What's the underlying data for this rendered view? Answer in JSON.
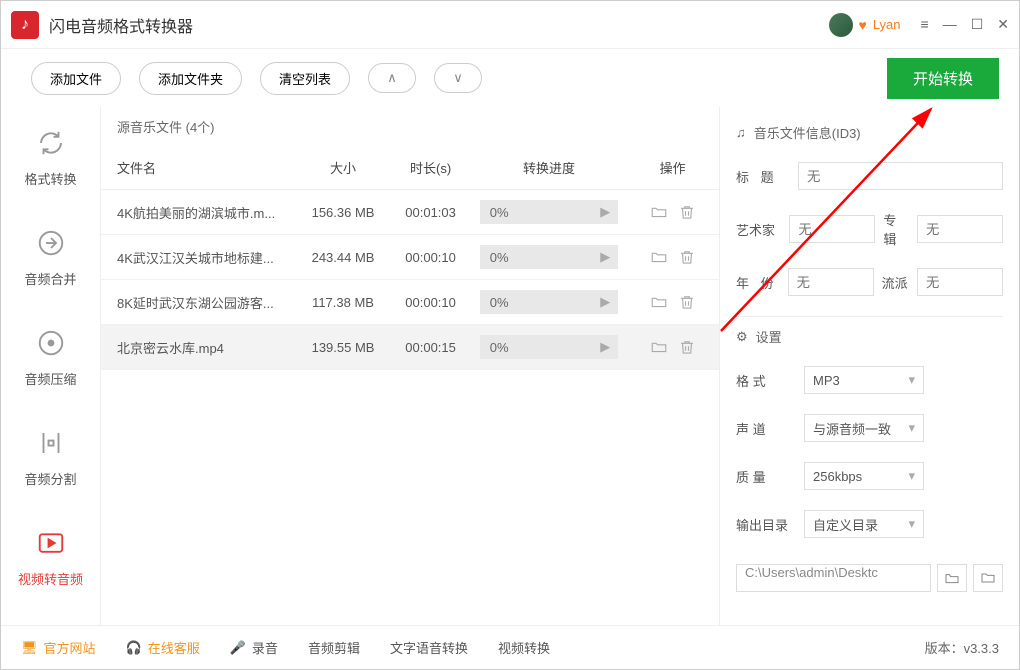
{
  "app": {
    "title": "闪电音频格式转换器"
  },
  "user": {
    "name": "Lyan"
  },
  "toolbar": {
    "add_file": "添加文件",
    "add_folder": "添加文件夹",
    "clear_list": "清空列表",
    "start": "开始转换"
  },
  "sidebar": {
    "items": [
      {
        "label": "格式转换"
      },
      {
        "label": "音频合并"
      },
      {
        "label": "音频压缩"
      },
      {
        "label": "音频分割"
      },
      {
        "label": "视频转音频"
      }
    ]
  },
  "list": {
    "title": "源音乐文件 (4个)",
    "headers": {
      "name": "文件名",
      "size": "大小",
      "duration": "时长(s)",
      "progress": "转换进度",
      "ops": "操作"
    },
    "rows": [
      {
        "name": "4K航拍美丽的湖滨城市.m...",
        "size": "156.36 MB",
        "duration": "00:01:03",
        "progress": "0%"
      },
      {
        "name": "4K武汉江汉关城市地标建...",
        "size": "243.44 MB",
        "duration": "00:00:10",
        "progress": "0%"
      },
      {
        "name": "8K延时武汉东湖公园游客...",
        "size": "117.38 MB",
        "duration": "00:00:10",
        "progress": "0%"
      },
      {
        "name": "北京密云水库.mp4",
        "size": "139.55 MB",
        "duration": "00:00:15",
        "progress": "0%"
      }
    ]
  },
  "info": {
    "title": "音乐文件信息(ID3)",
    "labels": {
      "title_l": "标 题",
      "artist": "艺术家",
      "album": "专辑",
      "year": "年 份",
      "genre": "流派"
    },
    "placeholder": "无"
  },
  "settings": {
    "title": "设置",
    "labels": {
      "format": "格  式",
      "channel": "声  道",
      "quality": "质  量",
      "outdir": "输出目录"
    },
    "values": {
      "format": "MP3",
      "channel": "与源音频一致",
      "quality": "256kbps",
      "outdir": "自定义目录"
    },
    "path": "C:\\Users\\admin\\Desktc"
  },
  "footer": {
    "items": [
      "官方网站",
      "在线客服",
      "录音",
      "音频剪辑",
      "文字语音转换",
      "视频转换"
    ],
    "version": "版本：v3.3.3"
  }
}
